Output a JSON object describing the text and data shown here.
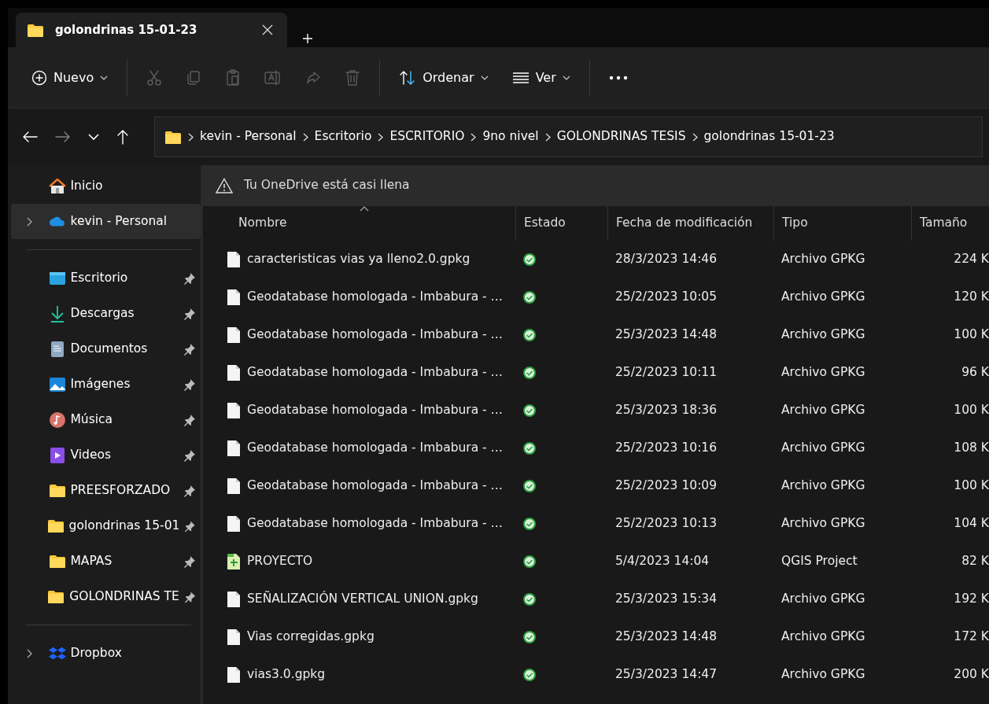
{
  "tab": {
    "title": "golondrinas 15-01-23"
  },
  "toolbar": [
    {
      "kind": "new",
      "label": "Nuevo",
      "dropdown": true,
      "disabled": false
    },
    {
      "kind": "cut",
      "disabled": true
    },
    {
      "kind": "copy",
      "disabled": true
    },
    {
      "kind": "paste",
      "disabled": true
    },
    {
      "kind": "rename",
      "disabled": true
    },
    {
      "kind": "share",
      "disabled": true
    },
    {
      "kind": "delete",
      "disabled": true
    },
    {
      "kind": "sort",
      "label": "Ordenar",
      "dropdown": true,
      "disabled": false
    },
    {
      "kind": "view",
      "label": "Ver",
      "dropdown": true,
      "disabled": false
    },
    {
      "kind": "more",
      "disabled": false
    }
  ],
  "navigation": [
    {
      "kind": "back",
      "disabled": false
    },
    {
      "kind": "forward",
      "disabled": true
    },
    {
      "kind": "recent",
      "disabled": false
    },
    {
      "kind": "up",
      "disabled": false
    }
  ],
  "breadcrumbs": [
    "kevin - Personal",
    "Escritorio",
    "ESCRITORIO",
    "9no nivel",
    "GOLONDRINAS TESIS",
    "golondrinas 15-01-23"
  ],
  "sidebar": {
    "groups": [
      [
        {
          "kind": "home",
          "label": "Inicio",
          "expandable": false,
          "pinned": false,
          "selected": false
        },
        {
          "kind": "cloud",
          "label": "kevin - Personal",
          "expandable": true,
          "pinned": false,
          "selected": true
        }
      ],
      [
        {
          "kind": "desktop",
          "label": "Escritorio",
          "expandable": false,
          "pinned": true,
          "selected": false
        },
        {
          "kind": "download",
          "label": "Descargas",
          "expandable": false,
          "pinned": true,
          "selected": false
        },
        {
          "kind": "documents",
          "label": "Documentos",
          "expandable": false,
          "pinned": true,
          "selected": false
        },
        {
          "kind": "pictures",
          "label": "Imágenes",
          "expandable": false,
          "pinned": true,
          "selected": false
        },
        {
          "kind": "music",
          "label": "Música",
          "expandable": false,
          "pinned": true,
          "selected": false
        },
        {
          "kind": "videos",
          "label": "Videos",
          "expandable": false,
          "pinned": true,
          "selected": false
        },
        {
          "kind": "folder",
          "label": "PREESFORZADO",
          "expandable": false,
          "pinned": true,
          "selected": false
        },
        {
          "kind": "folder",
          "label": "golondrinas 15-01",
          "expandable": false,
          "pinned": true,
          "selected": false
        },
        {
          "kind": "folder",
          "label": "MAPAS",
          "expandable": false,
          "pinned": true,
          "selected": false
        },
        {
          "kind": "folder",
          "label": "GOLONDRINAS TE",
          "expandable": false,
          "pinned": true,
          "selected": false
        }
      ],
      [
        {
          "kind": "dropbox",
          "label": "Dropbox",
          "expandable": true,
          "pinned": false,
          "selected": false
        }
      ]
    ]
  },
  "notice": {
    "text": "Tu OneDrive está casi llena"
  },
  "columns": [
    {
      "label": "Nombre",
      "sorted": true
    },
    {
      "label": "Estado",
      "sorted": false
    },
    {
      "label": "Fecha de modificación",
      "sorted": false
    },
    {
      "label": "Tipo",
      "sorted": false
    },
    {
      "label": "Tamaño",
      "sorted": false
    }
  ],
  "rows": [
    {
      "kind": "file",
      "name": "caracteristicas vias ya lleno2.0.gpkg",
      "synced": true,
      "modified": "28/3/2023 14:46",
      "type": "Archivo GPKG",
      "size": "224 K"
    },
    {
      "kind": "file",
      "name": "Geodatabase homologada - Imbabura - …",
      "synced": true,
      "modified": "25/2/2023 10:05",
      "type": "Archivo GPKG",
      "size": "120 K"
    },
    {
      "kind": "file",
      "name": "Geodatabase homologada - Imbabura - …",
      "synced": true,
      "modified": "25/3/2023 14:48",
      "type": "Archivo GPKG",
      "size": "100 K"
    },
    {
      "kind": "file",
      "name": "Geodatabase homologada - Imbabura - …",
      "synced": true,
      "modified": "25/2/2023 10:11",
      "type": "Archivo GPKG",
      "size": "96 K"
    },
    {
      "kind": "file",
      "name": "Geodatabase homologada - Imbabura - …",
      "synced": true,
      "modified": "25/3/2023 18:36",
      "type": "Archivo GPKG",
      "size": "100 K"
    },
    {
      "kind": "file",
      "name": "Geodatabase homologada - Imbabura - …",
      "synced": true,
      "modified": "25/2/2023 10:16",
      "type": "Archivo GPKG",
      "size": "108 K"
    },
    {
      "kind": "file",
      "name": "Geodatabase homologada - Imbabura - …",
      "synced": true,
      "modified": "25/2/2023 10:09",
      "type": "Archivo GPKG",
      "size": "100 K"
    },
    {
      "kind": "file",
      "name": "Geodatabase homologada - Imbabura - …",
      "synced": true,
      "modified": "25/2/2023 10:13",
      "type": "Archivo GPKG",
      "size": "104 K"
    },
    {
      "kind": "project",
      "name": "PROYECTO",
      "synced": true,
      "modified": "5/4/2023 14:04",
      "type": "QGIS Project",
      "size": "82 K"
    },
    {
      "kind": "file",
      "name": "SEÑALIZACIÓN VERTICAL UNION.gpkg",
      "synced": true,
      "modified": "25/3/2023 15:34",
      "type": "Archivo GPKG",
      "size": "192 K"
    },
    {
      "kind": "file",
      "name": "Vias corregidas.gpkg",
      "synced": true,
      "modified": "25/3/2023 14:48",
      "type": "Archivo GPKG",
      "size": "172 K"
    },
    {
      "kind": "file",
      "name": "vias3.0.gpkg",
      "synced": true,
      "modified": "25/3/2023 14:47",
      "type": "Archivo GPKG",
      "size": "200 K"
    }
  ]
}
